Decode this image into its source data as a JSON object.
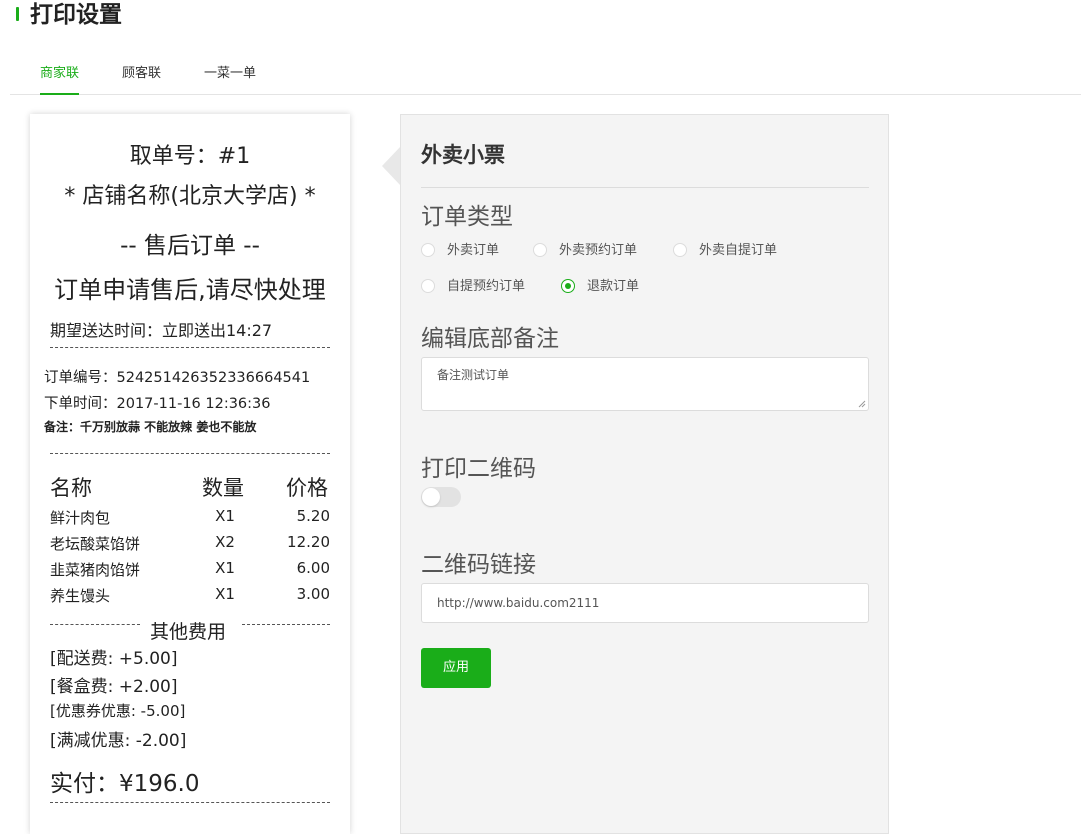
{
  "page_title": "打印设置",
  "tabs": [
    {
      "label": "商家联",
      "active": true
    },
    {
      "label": "顾客联",
      "active": false
    },
    {
      "label": "一菜一单",
      "active": false
    }
  ],
  "receipt": {
    "pickup_number": "取单号：#1",
    "store_name": "* 店铺名称(北京大学店) *",
    "after_sale": "-- 售后订单 --",
    "notice": "订单申请售后,请尽快处理",
    "expected_delivery": "期望送达时间：立即送出14:27",
    "order_number": "订单编号：524251426352336664541",
    "order_time": "下单时间：2017-11-16 12:36:36",
    "remark": "备注：千万别放蒜 不能放辣 姜也不能放",
    "columns": {
      "name": "名称",
      "qty": "数量",
      "price": "价格"
    },
    "items": [
      {
        "name": "鲜汁肉包",
        "qty": "X1",
        "price": "5.20"
      },
      {
        "name": "老坛酸菜馅饼",
        "qty": "X2",
        "price": "12.20"
      },
      {
        "name": "韭菜猪肉馅饼",
        "qty": "X1",
        "price": "6.00"
      },
      {
        "name": "养生馒头",
        "qty": "X1",
        "price": "3.00"
      }
    ],
    "other_fees_label": "其他费用",
    "fees": [
      "[配送费: +5.00]",
      "[餐盒费: +2.00]",
      "[优惠券优惠: -5.00]",
      "[满减优惠: -2.00]"
    ],
    "total": "实付：¥196.0"
  },
  "panel": {
    "title": "外卖小票",
    "order_type_heading": "订单类型",
    "order_types": [
      {
        "label": "外卖订单",
        "checked": false
      },
      {
        "label": "外卖预约订单",
        "checked": false
      },
      {
        "label": "外卖自提订单",
        "checked": false
      },
      {
        "label": "自提预约订单",
        "checked": false
      },
      {
        "label": "退款订单",
        "checked": true
      }
    ],
    "remark_heading": "编辑底部备注",
    "remark_value": "备注测试订单",
    "qrcode_heading": "打印二维码",
    "qrcode_enabled": false,
    "link_heading": "二维码链接",
    "link_value": "http://www.baidu.com2111",
    "apply_label": "应用"
  },
  "colors": {
    "accent": "#1aad19",
    "panel_bg": "#f4f4f4"
  }
}
